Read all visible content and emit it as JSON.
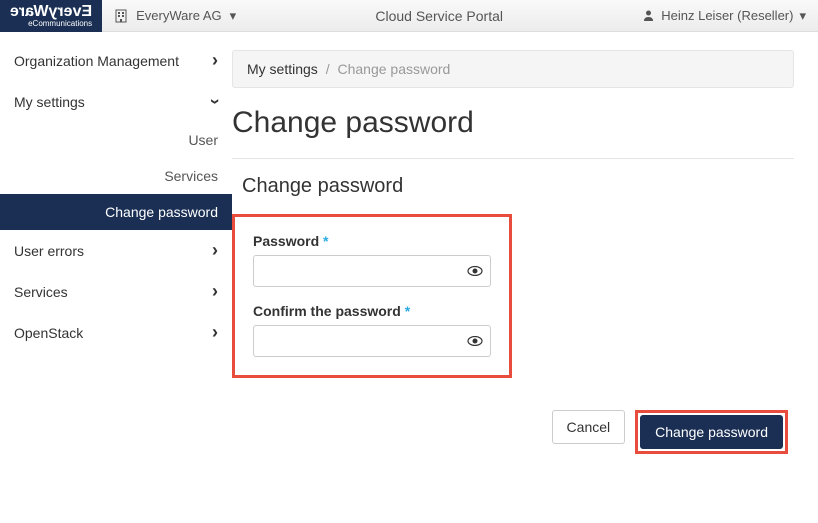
{
  "header": {
    "logo_main": "EveryWare",
    "logo_sub": "eCommunications",
    "org_label": "EveryWare AG",
    "portal_title": "Cloud Service Portal",
    "user_label": "Heinz Leiser (Reseller)"
  },
  "sidebar": {
    "org_mgmt": "Organization Management",
    "my_settings": "My settings",
    "sub": {
      "user": "User",
      "services": "Services",
      "change_password": "Change password"
    },
    "user_errors": "User errors",
    "services": "Services",
    "openstack": "OpenStack"
  },
  "breadcrumb": {
    "parent": "My settings",
    "current": "Change password"
  },
  "page": {
    "title": "Change password",
    "section_title": "Change password"
  },
  "form": {
    "password_label": "Password",
    "confirm_label": "Confirm the password"
  },
  "actions": {
    "cancel": "Cancel",
    "submit": "Change password"
  }
}
